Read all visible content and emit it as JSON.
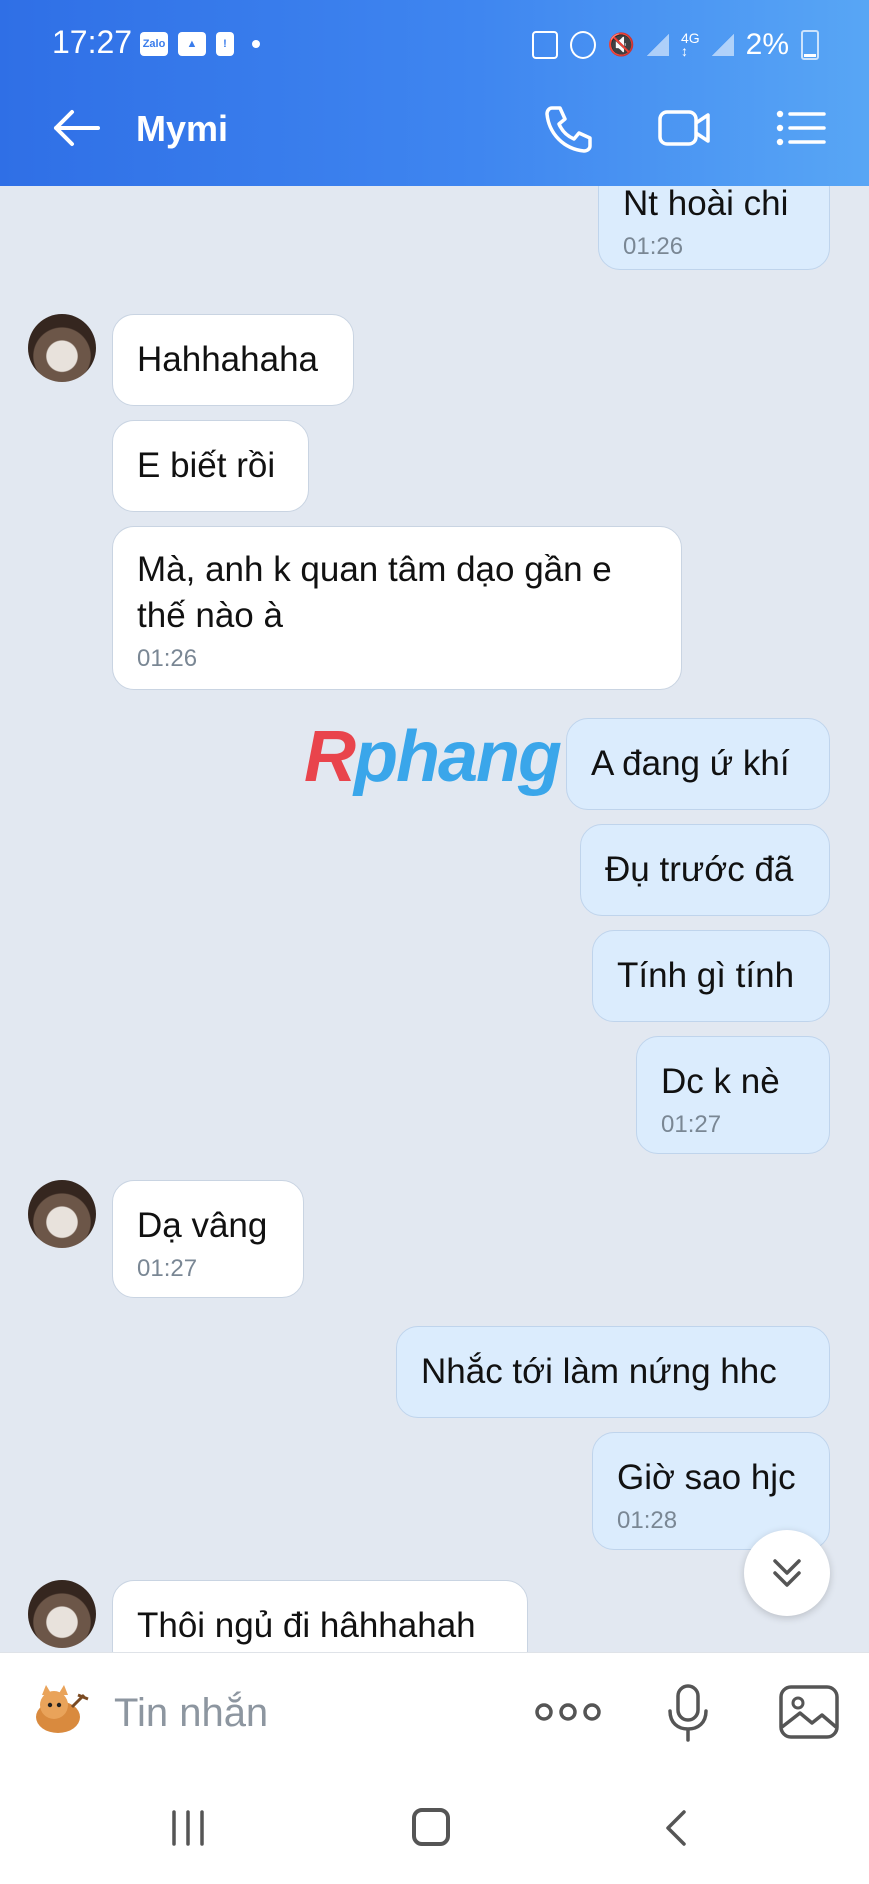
{
  "status": {
    "time": "17:27",
    "battery": "2%",
    "icons": [
      "zalo-icon",
      "gallery-icon",
      "alert-icon",
      "dot-icon",
      "nfc-icon",
      "alarm-icon",
      "mute-icon",
      "signal-icon",
      "4g-icon",
      "signal-icon",
      "battery-icon"
    ]
  },
  "header": {
    "title": "Mymi",
    "icons": [
      "back-arrow-icon",
      "phone-icon",
      "video-icon",
      "menu-list-icon"
    ]
  },
  "messages": [
    {
      "dir": "out",
      "text": "Nt hoài chi",
      "time": "01:26"
    },
    {
      "dir": "in",
      "text": "Hahhahaha",
      "time": ""
    },
    {
      "dir": "in",
      "text": "E biết rồi",
      "time": ""
    },
    {
      "dir": "in",
      "text": "Mà, anh k quan tâm dạo gần e thế nào à",
      "time": "01:26"
    },
    {
      "dir": "out",
      "text": "A đang ứ khí",
      "time": ""
    },
    {
      "dir": "out",
      "text": "Đụ trước đã",
      "time": ""
    },
    {
      "dir": "out",
      "text": "Tính gì tính",
      "time": ""
    },
    {
      "dir": "out",
      "text": "Dc k nè",
      "time": "01:27"
    },
    {
      "dir": "in",
      "text": "Dạ vâng",
      "time": "01:27"
    },
    {
      "dir": "out",
      "text": "Nhắc tới làm nứng hhc",
      "time": ""
    },
    {
      "dir": "out",
      "text": "Giờ sao hjc",
      "time": "01:28"
    },
    {
      "dir": "in",
      "text": "Thôi ngủ đi hâhhahah",
      "time": ""
    }
  ],
  "watermark": {
    "r": "R",
    "rest": "phang"
  },
  "composer": {
    "placeholder": "Tin nhắn",
    "icons": [
      "sticker-icon",
      "more-icon",
      "mic-icon",
      "image-icon"
    ]
  },
  "nav": {
    "icons": [
      "recent-apps-icon",
      "home-icon",
      "back-icon"
    ]
  },
  "colors": {
    "header": "#3f86f0",
    "chat_bg": "#e2e8f1",
    "bubble_in": "#ffffff",
    "bubble_out": "#dbecfd"
  }
}
